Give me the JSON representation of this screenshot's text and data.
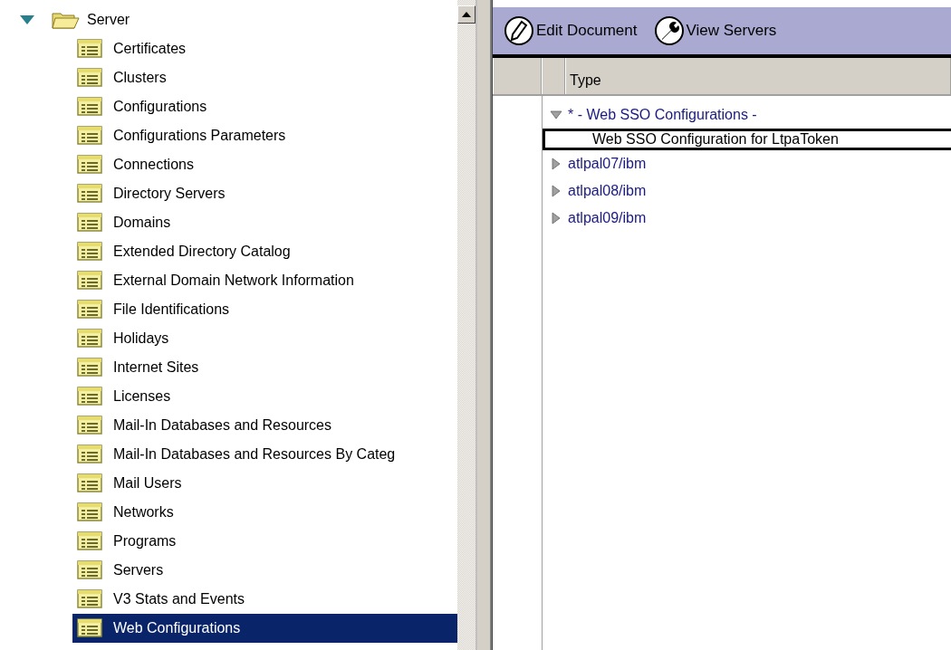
{
  "tree": {
    "label": "Server",
    "expanded": true,
    "children": [
      {
        "label": "Certificates",
        "selected": false
      },
      {
        "label": "Clusters",
        "selected": false
      },
      {
        "label": "Configurations",
        "selected": false
      },
      {
        "label": "Configurations Parameters",
        "selected": false
      },
      {
        "label": "Connections",
        "selected": false
      },
      {
        "label": "Directory Servers",
        "selected": false
      },
      {
        "label": "Domains",
        "selected": false
      },
      {
        "label": "Extended Directory Catalog",
        "selected": false
      },
      {
        "label": "External Domain Network Information",
        "selected": false
      },
      {
        "label": "File Identifications",
        "selected": false
      },
      {
        "label": "Holidays",
        "selected": false
      },
      {
        "label": "Internet Sites",
        "selected": false
      },
      {
        "label": "Licenses",
        "selected": false
      },
      {
        "label": "Mail-In Databases and Resources",
        "selected": false
      },
      {
        "label": "Mail-In Databases and Resources By Categ",
        "selected": false
      },
      {
        "label": "Mail Users",
        "selected": false
      },
      {
        "label": "Networks",
        "selected": false
      },
      {
        "label": "Programs",
        "selected": false
      },
      {
        "label": "Servers",
        "selected": false
      },
      {
        "label": "V3 Stats and Events",
        "selected": false
      },
      {
        "label": "Web Configurations",
        "selected": true
      }
    ]
  },
  "toolbar": {
    "buttons": [
      {
        "kind": "edit",
        "label": "Edit Document"
      },
      {
        "kind": "tool",
        "label": "View Servers"
      }
    ]
  },
  "view": {
    "columns": [
      "Type"
    ],
    "rows": [
      {
        "label": "* - Web SSO Configurations -",
        "expanded": true,
        "children": [
          {
            "label": "Web SSO Configuration for LtpaToken",
            "selected": true
          }
        ]
      },
      {
        "label": "atlpal07/ibm",
        "expanded": false
      },
      {
        "label": "atlpal08/ibm",
        "expanded": false
      },
      {
        "label": "atlpal09/ibm",
        "expanded": false
      }
    ]
  }
}
